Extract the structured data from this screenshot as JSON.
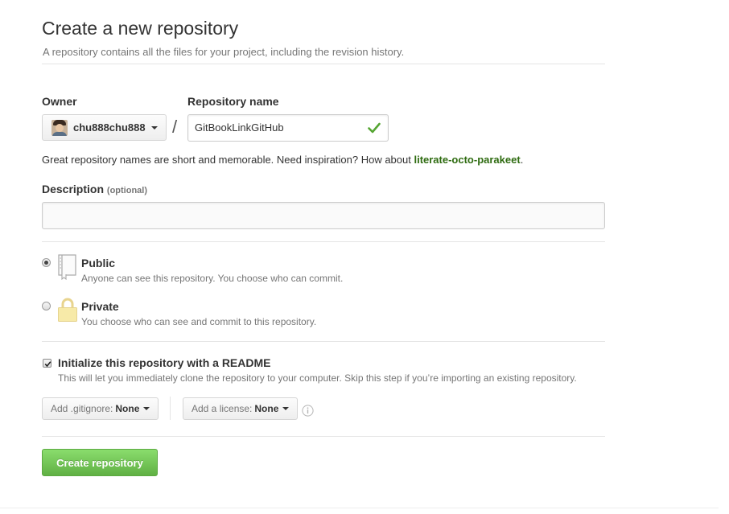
{
  "header": {
    "title": "Create a new repository",
    "subtitle": "A repository contains all the files for your project, including the revision history."
  },
  "owner": {
    "label": "Owner",
    "value": "chu888chu888"
  },
  "separator": "/",
  "repo_name": {
    "label": "Repository name",
    "value": "GitBookLinkGitHub"
  },
  "hint": {
    "text": "Great repository names are short and memorable. Need inspiration? How about ",
    "suggestion": "literate-octo-parakeet",
    "end": "."
  },
  "description": {
    "label": "Description",
    "optional": "(optional)",
    "value": ""
  },
  "visibility": {
    "selected": "public",
    "public": {
      "title": "Public",
      "desc": "Anyone can see this repository. You choose who can commit."
    },
    "private": {
      "title": "Private",
      "desc": "You choose who can see and commit to this repository."
    }
  },
  "readme": {
    "checked": true,
    "label": "Initialize this repository with a README",
    "desc": "This will let you immediately clone the repository to your computer. Skip this step if you’re importing an existing repository."
  },
  "gitignore": {
    "label": "Add .gitignore:",
    "value": "None"
  },
  "license": {
    "label": "Add a license:",
    "value": "None"
  },
  "info_icon": "info-icon",
  "submit": {
    "label": "Create repository"
  },
  "colors": {
    "suggestion": "#2e6b10",
    "check": "#55a532",
    "create_button": "#60b044"
  }
}
